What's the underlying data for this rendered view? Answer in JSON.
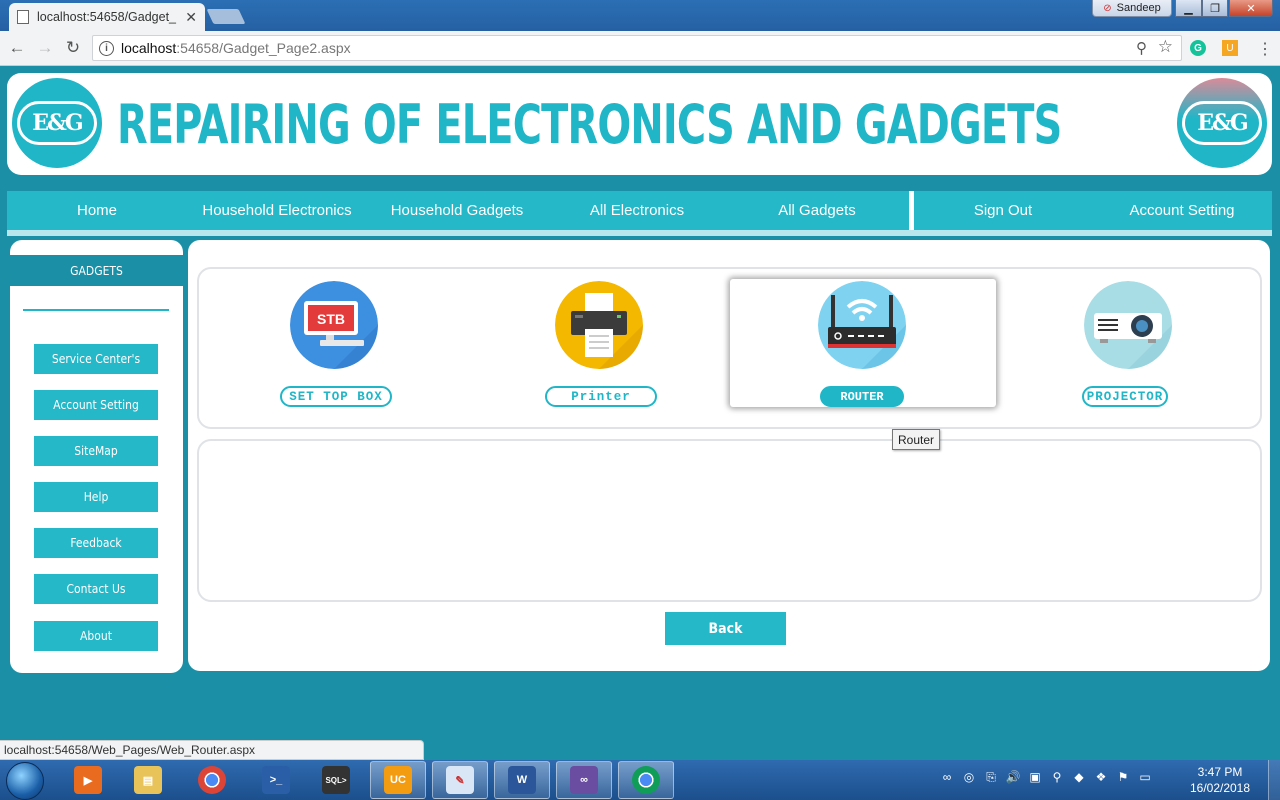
{
  "browser": {
    "tab_title": "localhost:54658/Gadget_",
    "url_host": "localhost",
    "url_path": ":54658/Gadget_Page2.aspx",
    "user_name": "Sandeep"
  },
  "header": {
    "title": "REPAIRING OF  ELECTRONICS AND GADGETS",
    "logo_text": "E&G"
  },
  "nav": {
    "items": [
      "Home",
      "Household Electronics",
      "Household Gadgets",
      "All Electronics",
      "All Gadgets",
      "Sign Out",
      "Account Setting"
    ]
  },
  "sidebar": {
    "heading": "GADGETS",
    "buttons": [
      "Service Center's",
      "Account Setting",
      "SiteMap",
      "Help",
      "Feedback",
      "Contact Us",
      "About"
    ]
  },
  "gadgets": [
    {
      "label": "SET TOP BOX",
      "icon": "set-top-box-icon",
      "icon_text": "STB"
    },
    {
      "label": "Printer",
      "icon": "printer-icon"
    },
    {
      "label": "ROUTER",
      "icon": "router-icon",
      "hovered": true
    },
    {
      "label": "PROJECTOR",
      "icon": "projector-icon"
    }
  ],
  "tooltip": "Router",
  "back_label": "Back",
  "status_url": "localhost:54658/Web_Pages/Web_Router.aspx",
  "taskbar": {
    "time": "3:47 PM",
    "date": "16/02/2018"
  },
  "colors": {
    "accent": "#20b6c7",
    "page_bg": "#1a8fa6"
  }
}
